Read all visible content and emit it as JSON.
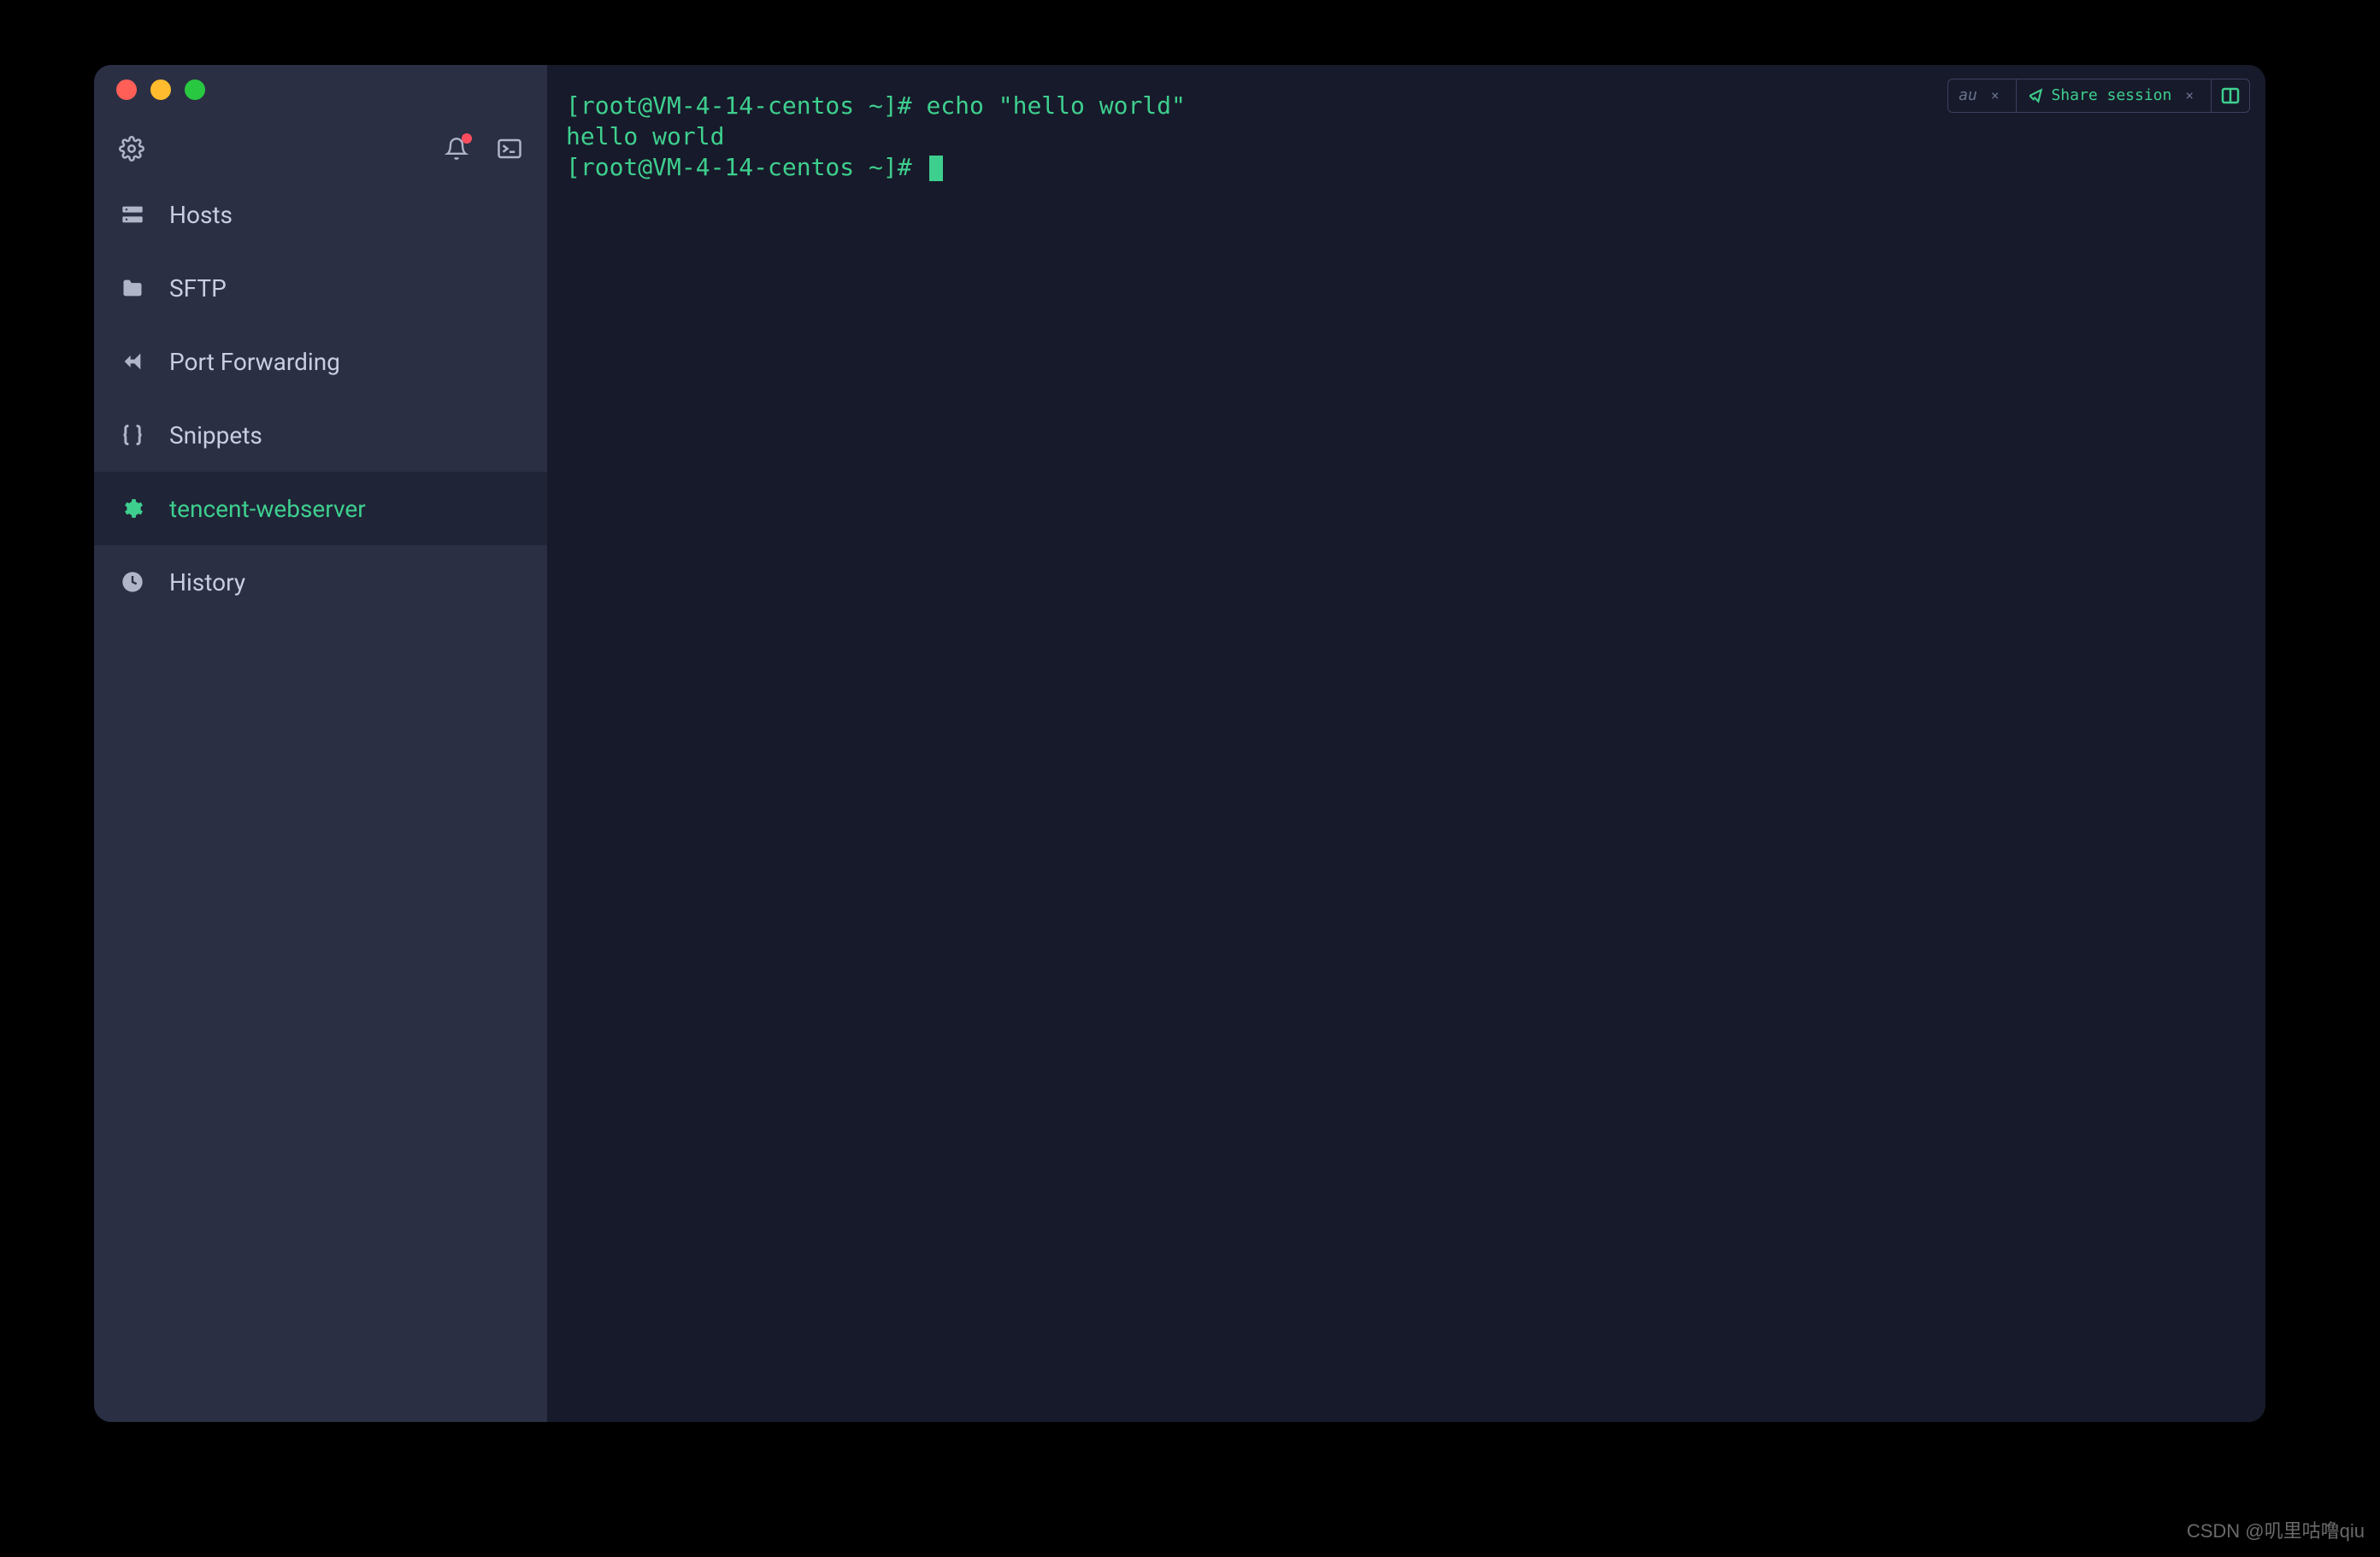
{
  "sidebar": {
    "items": [
      {
        "label": "Hosts",
        "icon": "hosts"
      },
      {
        "label": "SFTP",
        "icon": "folder"
      },
      {
        "label": "Port Forwarding",
        "icon": "forward"
      },
      {
        "label": "Snippets",
        "icon": "braces"
      },
      {
        "label": "tencent-webserver",
        "icon": "gear",
        "active": true
      },
      {
        "label": "History",
        "icon": "clock"
      }
    ]
  },
  "terminal": {
    "lines": [
      {
        "prompt": "[root@VM-4-14-centos ~]# ",
        "cmd": "echo \"hello world\""
      },
      {
        "output": "hello world"
      },
      {
        "prompt": "[root@VM-4-14-centos ~]# ",
        "cursor": true
      }
    ]
  },
  "topControls": {
    "chipLabel": "au",
    "shareLabel": "Share session"
  },
  "watermark": "CSDN @叽里咕噜qiu"
}
